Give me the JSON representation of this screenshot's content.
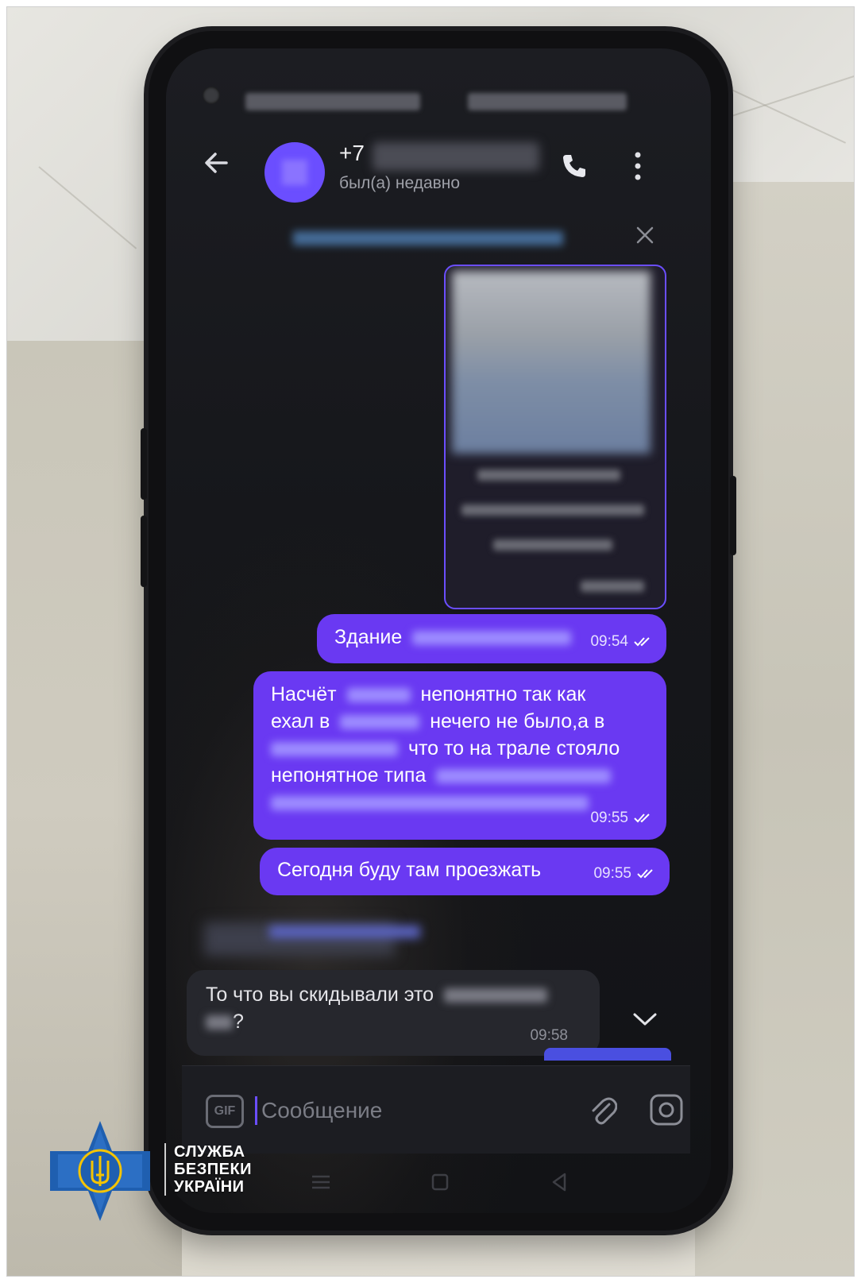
{
  "header": {
    "contact_prefix": "+7",
    "last_seen": "был(а) недавно"
  },
  "messages": {
    "outgoing": [
      {
        "text": "Здание",
        "time": "09:54"
      },
      {
        "lines": [
          "Насчёт",
          "непонятно так как",
          "ехал в",
          "нечего не было,а в",
          "что то на трале стояло",
          "непонятное типа"
        ],
        "time": "09:55"
      },
      {
        "text": "Сегодня буду там проезжать",
        "time": "09:55"
      }
    ],
    "incoming": {
      "text": "То что вы скидывали это",
      "suffix": "?",
      "time": "09:58"
    }
  },
  "composer": {
    "gif_label": "GIF",
    "placeholder": "Сообщение"
  },
  "logo": {
    "lines": [
      "СЛУЖБА",
      "БЕЗПЕКИ",
      "УКРАЇНИ"
    ],
    "shield_color": "#1f5fb0",
    "trident_color": "#f5c400"
  },
  "colors": {
    "accent": "#6a39f2",
    "background": "#16171b"
  }
}
